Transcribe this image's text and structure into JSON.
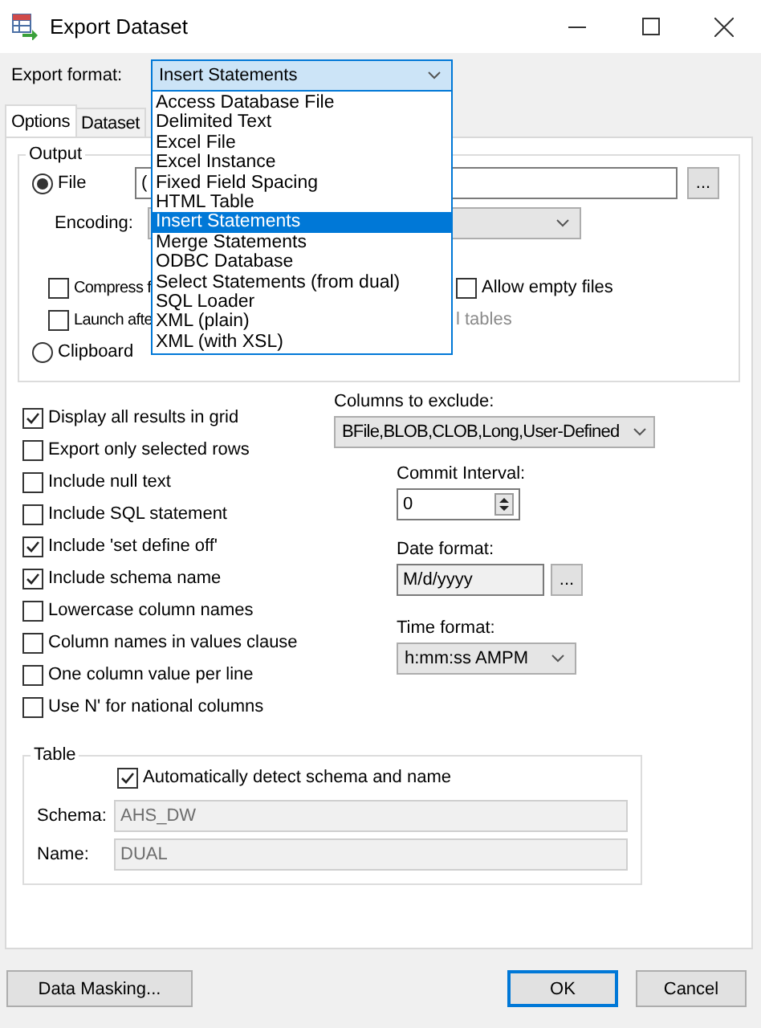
{
  "window": {
    "title": "Export Dataset"
  },
  "export_format": {
    "label": "Export format:",
    "value": "Insert Statements",
    "expanded": true,
    "options": [
      {
        "label": "Access Database File",
        "selected": false
      },
      {
        "label": "Delimited Text",
        "selected": false
      },
      {
        "label": "Excel File",
        "selected": false
      },
      {
        "label": "Excel Instance",
        "selected": false
      },
      {
        "label": "Fixed Field Spacing",
        "selected": false
      },
      {
        "label": "HTML Table",
        "selected": false
      },
      {
        "label": "Insert Statements",
        "selected": true
      },
      {
        "label": "Merge Statements",
        "selected": false
      },
      {
        "label": "ODBC Database",
        "selected": false
      },
      {
        "label": "Select Statements (from dual)",
        "selected": false
      },
      {
        "label": "SQL Loader",
        "selected": false
      },
      {
        "label": "XML (plain)",
        "selected": false
      },
      {
        "label": "XML (with XSL)",
        "selected": false
      }
    ]
  },
  "tabs": [
    {
      "label": "Options",
      "selected": true
    },
    {
      "label": "Dataset",
      "selected": false
    }
  ],
  "output": {
    "title": "Output",
    "destinations": [
      {
        "label": "File",
        "selected": true
      },
      {
        "label": "Clipboard",
        "selected": false
      }
    ],
    "file_path": "(",
    "browse": "...",
    "encoding_label": "Encoding:",
    "file_options": [
      {
        "label": "Compress f",
        "checked": false
      },
      {
        "label": "Launch afte",
        "checked": false
      }
    ],
    "allow_empty": {
      "label": "Allow empty files",
      "checked": false
    },
    "partial_text": "l tables"
  },
  "options": [
    {
      "label": "Display all results in grid",
      "checked": true
    },
    {
      "label": "Export only selected rows",
      "checked": false
    },
    {
      "label": "Include null text",
      "checked": false
    },
    {
      "label": "Include SQL statement",
      "checked": false
    },
    {
      "label": "Include 'set define off'",
      "checked": true
    },
    {
      "label": "Include schema name",
      "checked": true
    },
    {
      "label": "Lowercase column names",
      "checked": false
    },
    {
      "label": "Column names in values clause",
      "checked": false
    },
    {
      "label": "One column value per line",
      "checked": false
    },
    {
      "label": "Use N' for national columns",
      "checked": false
    }
  ],
  "columns_to_exclude": {
    "label": "Columns to exclude:",
    "value": "BFile,BLOB,CLOB,Long,User-Defined"
  },
  "commit_interval": {
    "label": "Commit Interval:",
    "value": "0"
  },
  "date_format": {
    "label": "Date format:",
    "value": "M/d/yyyy",
    "browse": "..."
  },
  "time_format": {
    "label": "Time format:",
    "value": "h:mm:ss AMPM"
  },
  "table": {
    "title": "Table",
    "auto_detect": {
      "label": "Automatically detect schema and name",
      "checked": true
    },
    "fields": [
      {
        "label": "Schema:",
        "value": "AHS_DW",
        "disabled": true
      },
      {
        "label": "Name:",
        "value": "DUAL",
        "disabled": true
      }
    ]
  },
  "buttons": [
    {
      "label": "Data Masking...",
      "default": false
    },
    {
      "label": "OK",
      "default": true
    },
    {
      "label": "Cancel",
      "default": false
    }
  ]
}
